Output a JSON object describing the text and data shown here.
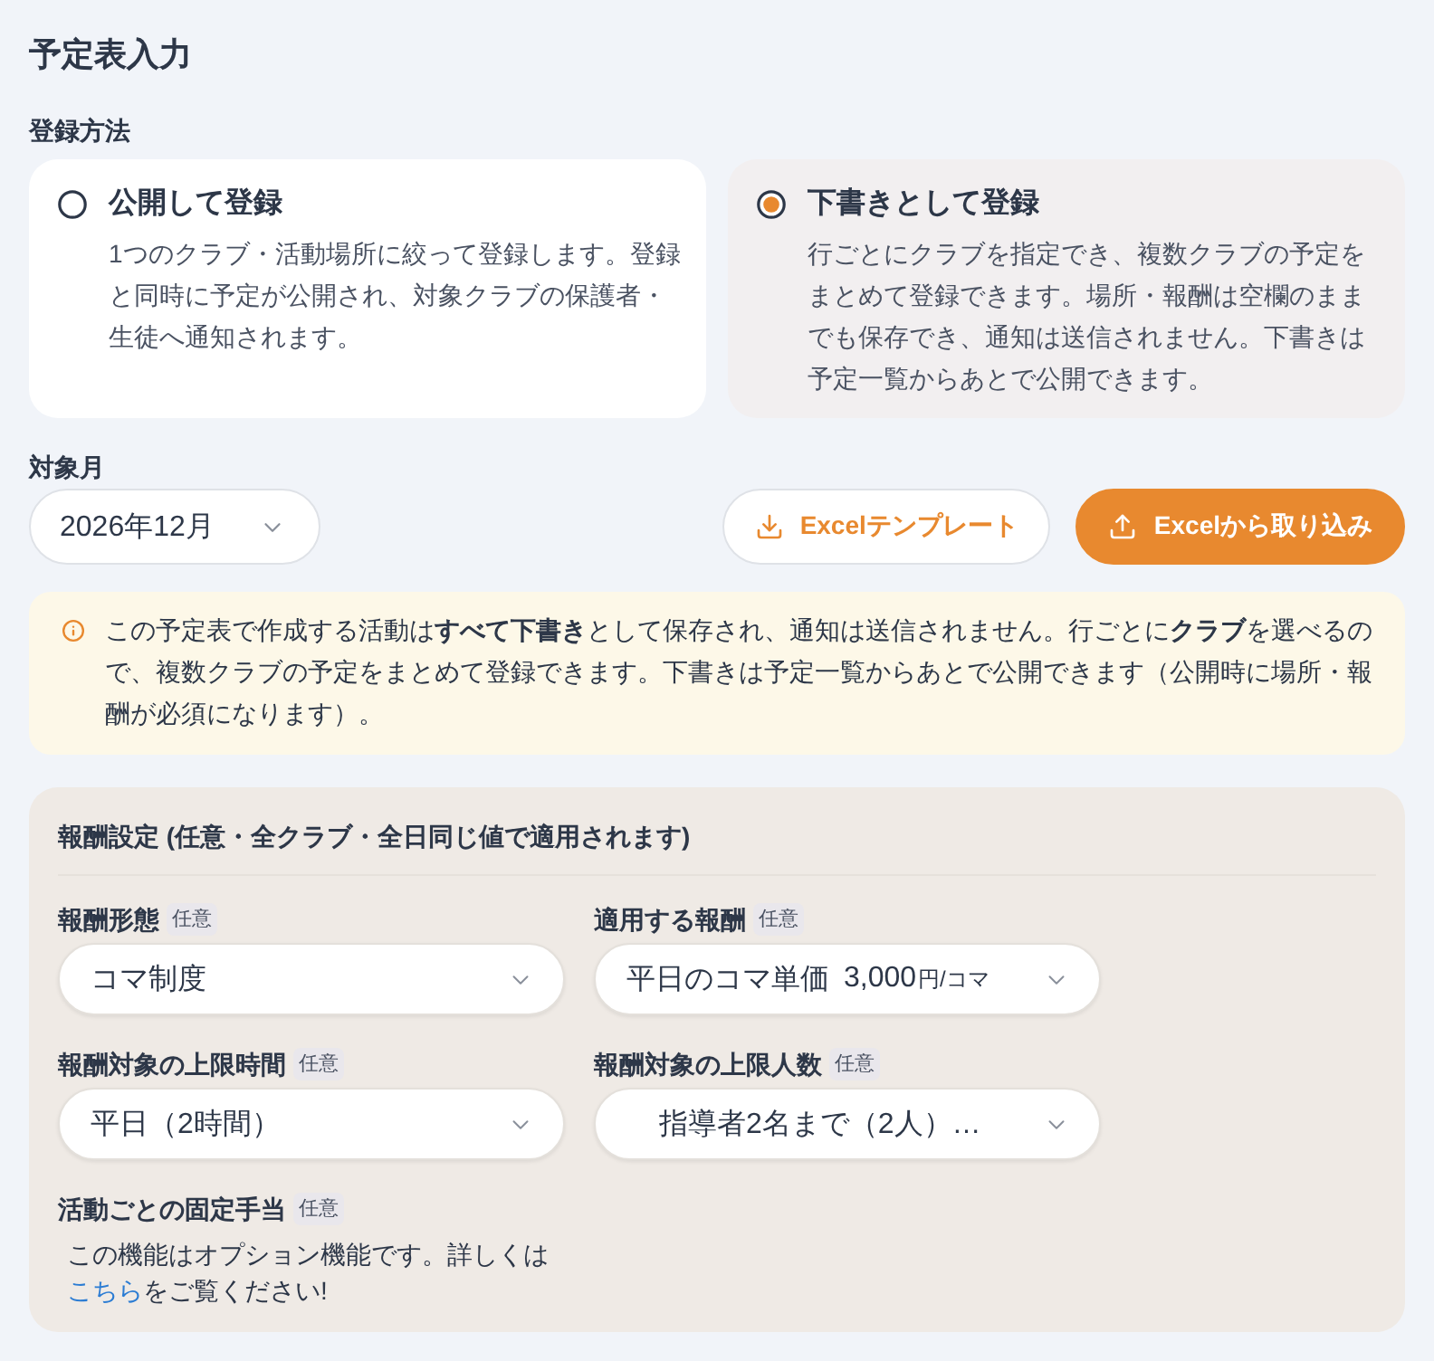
{
  "page": {
    "title": "予定表入力"
  },
  "registration": {
    "label": "登録方法",
    "options": [
      {
        "title": "公開して登録",
        "description": "1つのクラブ・活動場所に絞って登録します。登録と同時に予定が公開され、対象クラブの保護者・生徒へ通知されます。",
        "selected": false
      },
      {
        "title": "下書きとして登録",
        "description": "行ごとにクラブを指定でき、複数クラブの予定をまとめて登録できます。場所・報酬は空欄のままでも保存でき、通知は送信されません。下書きは予定一覧からあとで公開できます。",
        "selected": true
      }
    ]
  },
  "month": {
    "label": "対象月",
    "value": "2026年12月"
  },
  "actions": [
    {
      "kind": "download",
      "label": "Excelテンプレート"
    },
    {
      "kind": "upload",
      "label": "Excelから取り込み"
    }
  ],
  "notice": {
    "text": "この予定表で作成する活動は**すべて下書き**として保存され、通知は送信されません。行ごとに**クラブ**を選べるので、複数クラブの予定をまとめて登録できます。下書きは予定一覧からあとで公開できます（公開時に場所・報酬が必須になります）。"
  },
  "reward": {
    "title": "報酬設定 (任意・全クラブ・全日同じ値で適用されます)",
    "fields": [
      {
        "label": "報酬形態",
        "badge": "任意",
        "value": "コマ制度"
      },
      {
        "label": "適用する報酬",
        "badge": "任意",
        "value": "平日のコマ単価",
        "amount": "3,000",
        "unit": "円/コマ"
      },
      {
        "label": "報酬対象の上限時間",
        "badge": "任意",
        "value": "平日（2時間）"
      },
      {
        "label": "報酬対象の上限人数",
        "badge": "任意",
        "value": "指導者2名まで（2人）…"
      }
    ],
    "allowance": {
      "label": "活動ごとの固定手当",
      "badge": "任意",
      "text": "この機能はオプション機能です。詳しくは",
      "link": "こちら",
      "text_after": "をご覧ください!"
    }
  }
}
